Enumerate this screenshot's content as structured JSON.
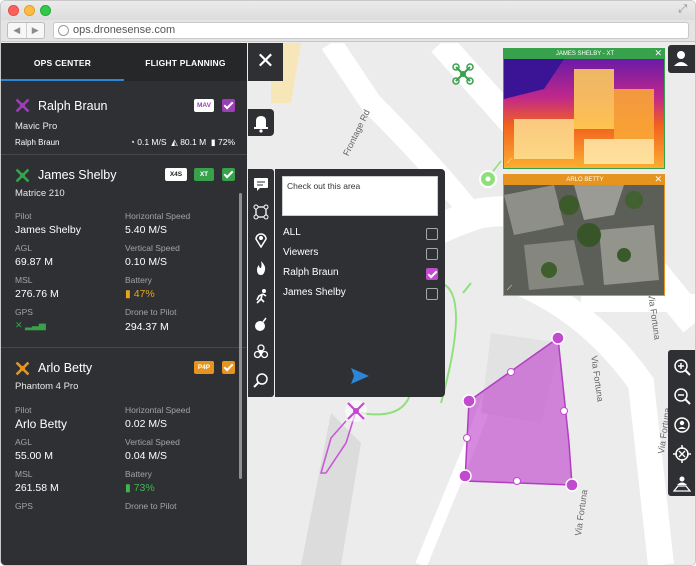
{
  "browser": {
    "url": "ops.dronesense.com"
  },
  "tabs": [
    {
      "label": "OPS CENTER",
      "active": true
    },
    {
      "label": "FLIGHT PLANNING",
      "active": false
    }
  ],
  "drones": [
    {
      "name": "Ralph Braun",
      "model": "Mavic Pro",
      "color": "#9b3fb5",
      "badge": "MAV",
      "pilot_short": "Ralph Braun",
      "speed": "0.1 M/S",
      "altitude": "80.1 M",
      "battery": "72%"
    },
    {
      "name": "James Shelby",
      "model": "Matrice 210",
      "color": "#37a24b",
      "badges": [
        "X4S",
        "XT"
      ],
      "labels": {
        "pilot": "Pilot",
        "hspeed": "Horizontal Speed",
        "agl": "AGL",
        "vspeed": "Vertical Speed",
        "msl": "MSL",
        "battery": "Battery",
        "gps": "GPS",
        "dtp": "Drone to Pilot"
      },
      "pilot": "James Shelby",
      "hspeed": "5.40 M/S",
      "agl": "69.87 M",
      "vspeed": "0.10 M/S",
      "msl": "276.76 M",
      "battery": "47%",
      "battery_color": "#e4a61c",
      "drone_to_pilot": "294.37 M"
    },
    {
      "name": "Arlo Betty",
      "model": "Phantom 4 Pro",
      "color": "#e5951f",
      "badge": "P4P",
      "labels": {
        "pilot": "Pilot",
        "hspeed": "Horizontal Speed",
        "agl": "AGL",
        "vspeed": "Vertical Speed",
        "msl": "MSL",
        "battery": "Battery",
        "gps": "GPS",
        "dtp": "Drone to Pilot"
      },
      "pilot": "Arlo Betty",
      "hspeed": "0.02 M/S",
      "agl": "55.00 M",
      "vspeed": "0.04 M/S",
      "msl": "261.58 M",
      "battery": "73%",
      "battery_color": "#3fb64f"
    }
  ],
  "message": {
    "text": "Check out this area",
    "recipients": [
      {
        "label": "ALL",
        "checked": false
      },
      {
        "label": "Viewers",
        "checked": false
      },
      {
        "label": "Ralph Braun",
        "checked": true
      },
      {
        "label": "James Shelby",
        "checked": false
      }
    ]
  },
  "feeds": [
    {
      "title": "JAMES SHELBY - XT",
      "border": "#37a24b"
    },
    {
      "title": "ARLO BETTY",
      "border": "#e5951f"
    }
  ],
  "map_labels": {
    "frontage": "Frontage Rd",
    "vialfortuna": "Via Fortuna"
  },
  "icons": {
    "close": "close-icon",
    "bell": "bell-icon",
    "user": "user-icon",
    "zoom_in": "zoom-in-icon",
    "zoom_out": "zoom-out-icon"
  }
}
